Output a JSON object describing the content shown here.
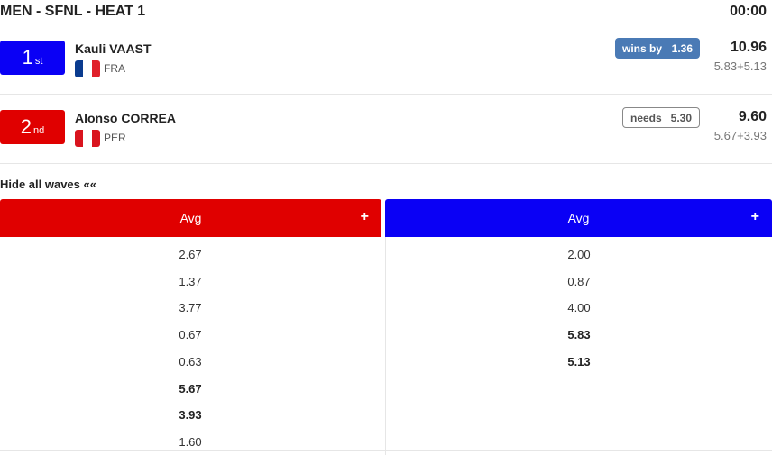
{
  "heat": {
    "title": "MEN - SFNL - HEAT 1",
    "timer": "00:00"
  },
  "athletes": [
    {
      "place": "1",
      "place_suffix": "st",
      "name": "Kauli VAAST",
      "country": "FRA",
      "status_label": "wins by",
      "status_value": "1.36",
      "total": "10.96",
      "wave_sum": "5.83+5.13",
      "badge_color": "#0a00f5",
      "flag_colors": [
        "#0a3b8f",
        "#ffffff",
        "#e0202a"
      ]
    },
    {
      "place": "2",
      "place_suffix": "nd",
      "name": "Alonso CORREA",
      "country": "PER",
      "status_label": "needs",
      "status_value": "5.30",
      "total": "9.60",
      "wave_sum": "5.67+3.93",
      "badge_color": "#e00000",
      "flag_colors": [
        "#d9141e",
        "#ffffff",
        "#d9141e"
      ]
    }
  ],
  "toggle_waves": "Hide all waves ««",
  "columns": [
    {
      "header": "Avg",
      "plus": "+",
      "color": "#e00000",
      "waves": [
        {
          "score": "2.67",
          "counting": false
        },
        {
          "score": "1.37",
          "counting": false
        },
        {
          "score": "3.77",
          "counting": false
        },
        {
          "score": "0.67",
          "counting": false
        },
        {
          "score": "0.63",
          "counting": false
        },
        {
          "score": "5.67",
          "counting": true
        },
        {
          "score": "3.93",
          "counting": true
        },
        {
          "score": "1.60",
          "counting": false
        }
      ]
    },
    {
      "header": "Avg",
      "plus": "+",
      "color": "#0a00f5",
      "waves": [
        {
          "score": "2.00",
          "counting": false
        },
        {
          "score": "0.87",
          "counting": false
        },
        {
          "score": "4.00",
          "counting": false
        },
        {
          "score": "5.83",
          "counting": true
        },
        {
          "score": "5.13",
          "counting": true
        }
      ]
    }
  ]
}
